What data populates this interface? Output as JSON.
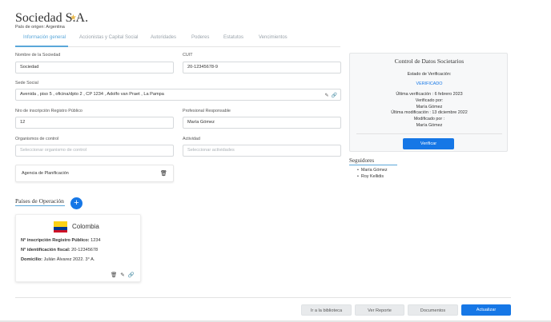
{
  "header": {
    "company_name": "Sociedad S.A.",
    "favorite_icon": "star-icon",
    "origin_country": "País de origen: Argentina"
  },
  "tabs": [
    {
      "label": "Información general",
      "active": true
    },
    {
      "label": "Accionistas y Capital Social",
      "active": false
    },
    {
      "label": "Autoridades",
      "active": false
    },
    {
      "label": "Poderes",
      "active": false
    },
    {
      "label": "Estatutos",
      "active": false
    },
    {
      "label": "Vencimientos",
      "active": false
    }
  ],
  "form": {
    "name_label": "Nombre de la Sociedad",
    "name_value": "Sociedad",
    "cuit_label": "CUIT",
    "cuit_value": "20-12345678-9",
    "address_label": "Sede Social",
    "address_value": "Avenida , piso 5 , oficina/dpto 2 , CP 1234 , Adolfo van Praet , La Pampa",
    "registry_label": "Nro de inscripción Registro Público",
    "registry_value": "12",
    "responsible_label": "Profesional Responsable",
    "responsible_value": "María Gómez",
    "control_label": "Organismos de control",
    "control_placeholder": "Seleccionar organismo de control",
    "activity_label": "Actividad",
    "activity_placeholder": "Seleccionar actividades",
    "agency": "Agencia de Planificación"
  },
  "control_panel": {
    "title": "Control de Datos Societarios",
    "status_label": "Estado de Verificación:",
    "status_value": "VERIFICADO",
    "last_verification": "Última verificación : 6 febrero 2023",
    "verified_by_label": "Verificado por:",
    "verified_by": "María Gómez",
    "last_modification": "Última modificación : 13 diciembre 2022",
    "modified_by_label": "Modificado por :",
    "modified_by": "María Gómez",
    "verify_button": "Verificar",
    "status_color": "#1677e6"
  },
  "followers": {
    "title": "Seguidores",
    "items": [
      "María Gómez",
      "Roy Kellidis"
    ]
  },
  "operations": {
    "title": "Países de Operación",
    "add_icon": "plus-icon",
    "country": {
      "name": "Colombia",
      "registry_label": "N° inscripción Registro Público:",
      "registry_value": "1234",
      "tax_label": "N° identificación fiscal:",
      "tax_value": "20-12345678",
      "address_label": "Domicilio:",
      "address_value": "Julián Álvarez 2022. 3° A."
    }
  },
  "footer": {
    "library_button": "Ir a la biblioteca",
    "report_button": "Ver Reporte",
    "documents_button": "Documentos",
    "update_button": "Actualizar"
  },
  "colors": {
    "primary": "#1677e6",
    "accent": "#5aa7d9",
    "star": "#e8b84a"
  }
}
